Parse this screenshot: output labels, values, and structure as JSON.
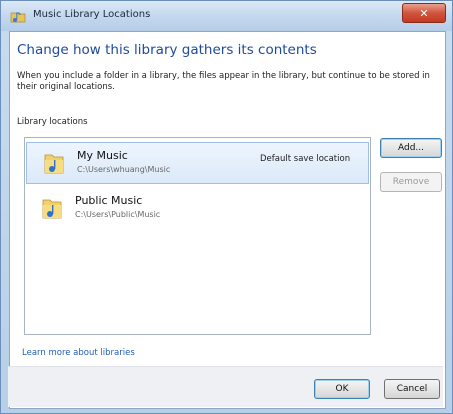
{
  "window": {
    "title": "Music Library Locations",
    "close_glyph": "✕"
  },
  "content": {
    "heading": "Change how this library gathers its contents",
    "description": "When you include a folder in a library, the files appear in the library, but continue to be stored in their original locations.",
    "locations_label": "Library locations",
    "learn_more_link": "Learn more about libraries"
  },
  "locations": [
    {
      "name": "My Music",
      "path": "C:\\Users\\whuang\\Music",
      "note": "Default save location",
      "selected": true
    },
    {
      "name": "Public Music",
      "path": "C:\\Users\\Public\\Music",
      "note": "",
      "selected": false
    }
  ],
  "buttons": {
    "add": "Add...",
    "remove": "Remove",
    "ok": "OK",
    "cancel": "Cancel"
  },
  "colors": {
    "heading": "#1e4a9c",
    "link": "#1f5fb8",
    "close_button": "#c13a23"
  },
  "icons": {
    "title": "music-library-icon",
    "folder": "music-folder-icon"
  }
}
